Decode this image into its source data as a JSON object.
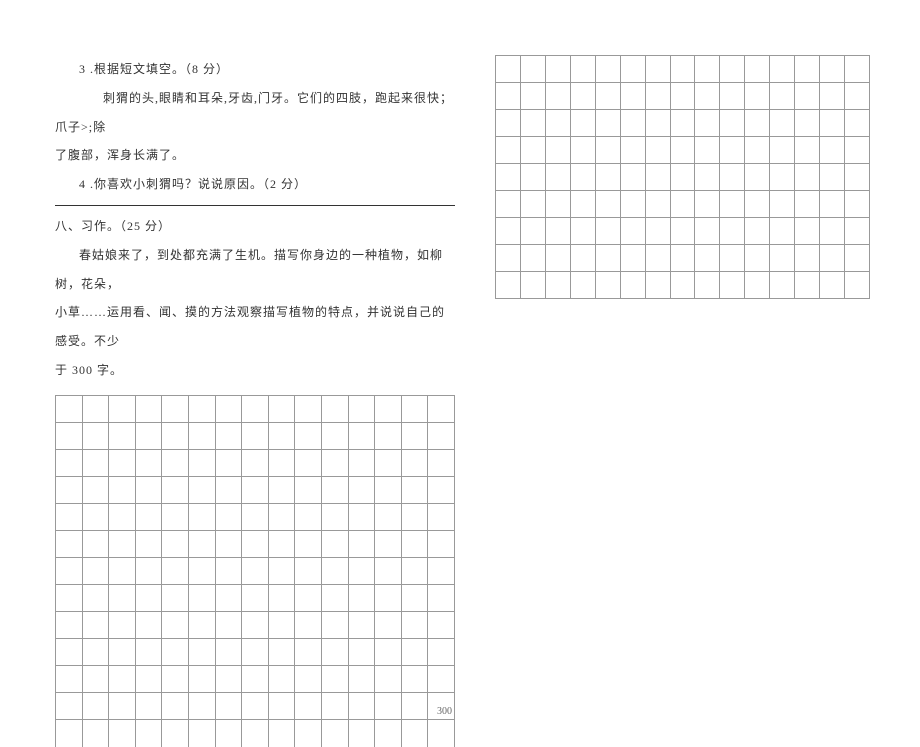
{
  "left": {
    "q3_label": "3 .根据短文填空。（8 分）",
    "q3_body_line1": "刺猬的头,眼睛和耳朵,牙齿,门牙。它们的四肢，跑起来很快；爪子>;除",
    "q3_body_line2": "了腹部，浑身长满了。",
    "q4_label": "4 .你喜欢小刺猬吗？说说原因。（2 分）",
    "section8_title": "八、习作。（25 分）",
    "essay_prompt_line1": "春姑娘来了，到处都充满了生机。描写你身边的一种植物，如柳树，花朵，",
    "essay_prompt_line2": "小草……运用看、闻、摸的方法观察描写植物的特点，并说说自己的感受。不少",
    "essay_prompt_line3": "于 300 字。",
    "grid_cell_300": "300"
  },
  "grids": {
    "left_cols": 15,
    "left_rows": 13,
    "right_cols": 15,
    "right_rows": 9
  }
}
